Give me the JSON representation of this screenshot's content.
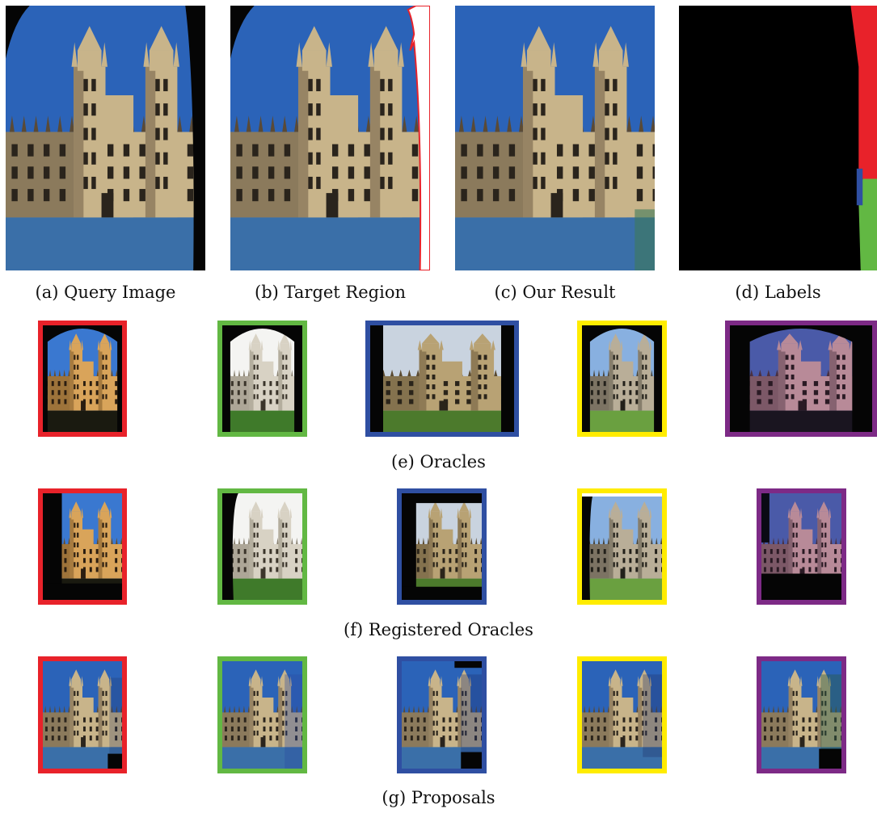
{
  "top_panels": [
    {
      "caption": "(a) Query Image",
      "variant": "query"
    },
    {
      "caption": "(b) Target Region",
      "variant": "target"
    },
    {
      "caption": "(c) Our Result",
      "variant": "result"
    },
    {
      "caption": "(d) Labels",
      "variant": "labels"
    }
  ],
  "rows": [
    {
      "caption": "(e) Oracles",
      "variant": "oracle"
    },
    {
      "caption": "(f) Registered Oracles",
      "variant": "registered"
    },
    {
      "caption": "(g) Proposals",
      "variant": "proposal"
    }
  ],
  "border_colors": [
    "#e8222a",
    "#62b843",
    "#2f4fa2",
    "#ffec00",
    "#7d2a86"
  ],
  "label_colors": {
    "background": "#000000",
    "red": "#e8222a",
    "green": "#62b843",
    "blue": "#2f4fa2"
  },
  "target_outline_color": "#e8222a"
}
